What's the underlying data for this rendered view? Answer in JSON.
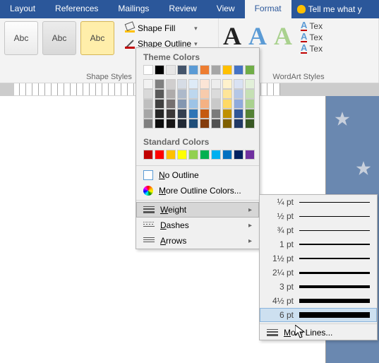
{
  "tabs": [
    "Layout",
    "References",
    "Mailings",
    "Review",
    "View",
    "Format"
  ],
  "active_tab": "Format",
  "tell_me": "Tell me what y",
  "shape_styles_label": "Shape Styles",
  "wordart_label": "WordArt Styles",
  "abc": "Abc",
  "shape_fill": "Shape Fill",
  "shape_outline": "Shape Outline",
  "tex": "Tex",
  "dropdown": {
    "theme_colors": "Theme Colors",
    "standard_colors": "Standard Colors",
    "no_outline": "No Outline",
    "more_colors": "More Outline Colors...",
    "weight": "Weight",
    "dashes": "Dashes",
    "arrows": "Arrows",
    "theme_row1": [
      "#ffffff",
      "#000000",
      "#e7e6e6",
      "#44546a",
      "#5b9bd5",
      "#ed7d31",
      "#a5a5a5",
      "#ffc000",
      "#4472c4",
      "#70ad47"
    ],
    "theme_shades": [
      [
        "#f2f2f2",
        "#808080",
        "#d0cece",
        "#d6dce5",
        "#deebf7",
        "#fbe5d6",
        "#ededed",
        "#fff2cc",
        "#d9e2f3",
        "#e2f0d9"
      ],
      [
        "#d9d9d9",
        "#595959",
        "#aeabab",
        "#adb9ca",
        "#bdd7ee",
        "#f7cbac",
        "#dbdbdb",
        "#fee599",
        "#b4c7e7",
        "#c5e0b4"
      ],
      [
        "#bfbfbf",
        "#404040",
        "#757070",
        "#8497b0",
        "#9dc3e6",
        "#f4b183",
        "#c9c9c9",
        "#ffd966",
        "#8faadc",
        "#a9d18e"
      ],
      [
        "#a6a6a6",
        "#262626",
        "#3b3838",
        "#333f50",
        "#2e75b6",
        "#c55a11",
        "#7b7b7b",
        "#bf9000",
        "#2f5597",
        "#548235"
      ],
      [
        "#7f7f7f",
        "#0d0d0d",
        "#171616",
        "#222a35",
        "#1f4e79",
        "#843c0c",
        "#525252",
        "#7f6000",
        "#203864",
        "#385723"
      ]
    ],
    "standard_row": [
      "#c00000",
      "#ff0000",
      "#ffc000",
      "#ffff00",
      "#92d050",
      "#00b050",
      "#00b0f0",
      "#0070c0",
      "#002060",
      "#7030a0"
    ]
  },
  "weights": [
    {
      "label": "¼ pt",
      "h": 0.5
    },
    {
      "label": "½ pt",
      "h": 1
    },
    {
      "label": "¾ pt",
      "h": 1
    },
    {
      "label": "1 pt",
      "h": 1.5
    },
    {
      "label": "1½ pt",
      "h": 2
    },
    {
      "label": "2¼ pt",
      "h": 3
    },
    {
      "label": "3 pt",
      "h": 4
    },
    {
      "label": "4½ pt",
      "h": 6
    },
    {
      "label": "6 pt",
      "h": 8
    }
  ],
  "more_lines": "More Lines...",
  "letter_A": "A",
  "n_char": "N",
  "m_char": "M",
  "w_char": "W",
  "d_char": "D",
  "a_char": "A",
  "o_outline_rest": "o Outline",
  "ore_colors_rest": "ore Outline Colors...",
  "eight_rest": "eight",
  "ashes_rest": "ashes",
  "rrows_rest": "rrows",
  "ore_lines_rest": "ore Lines..."
}
